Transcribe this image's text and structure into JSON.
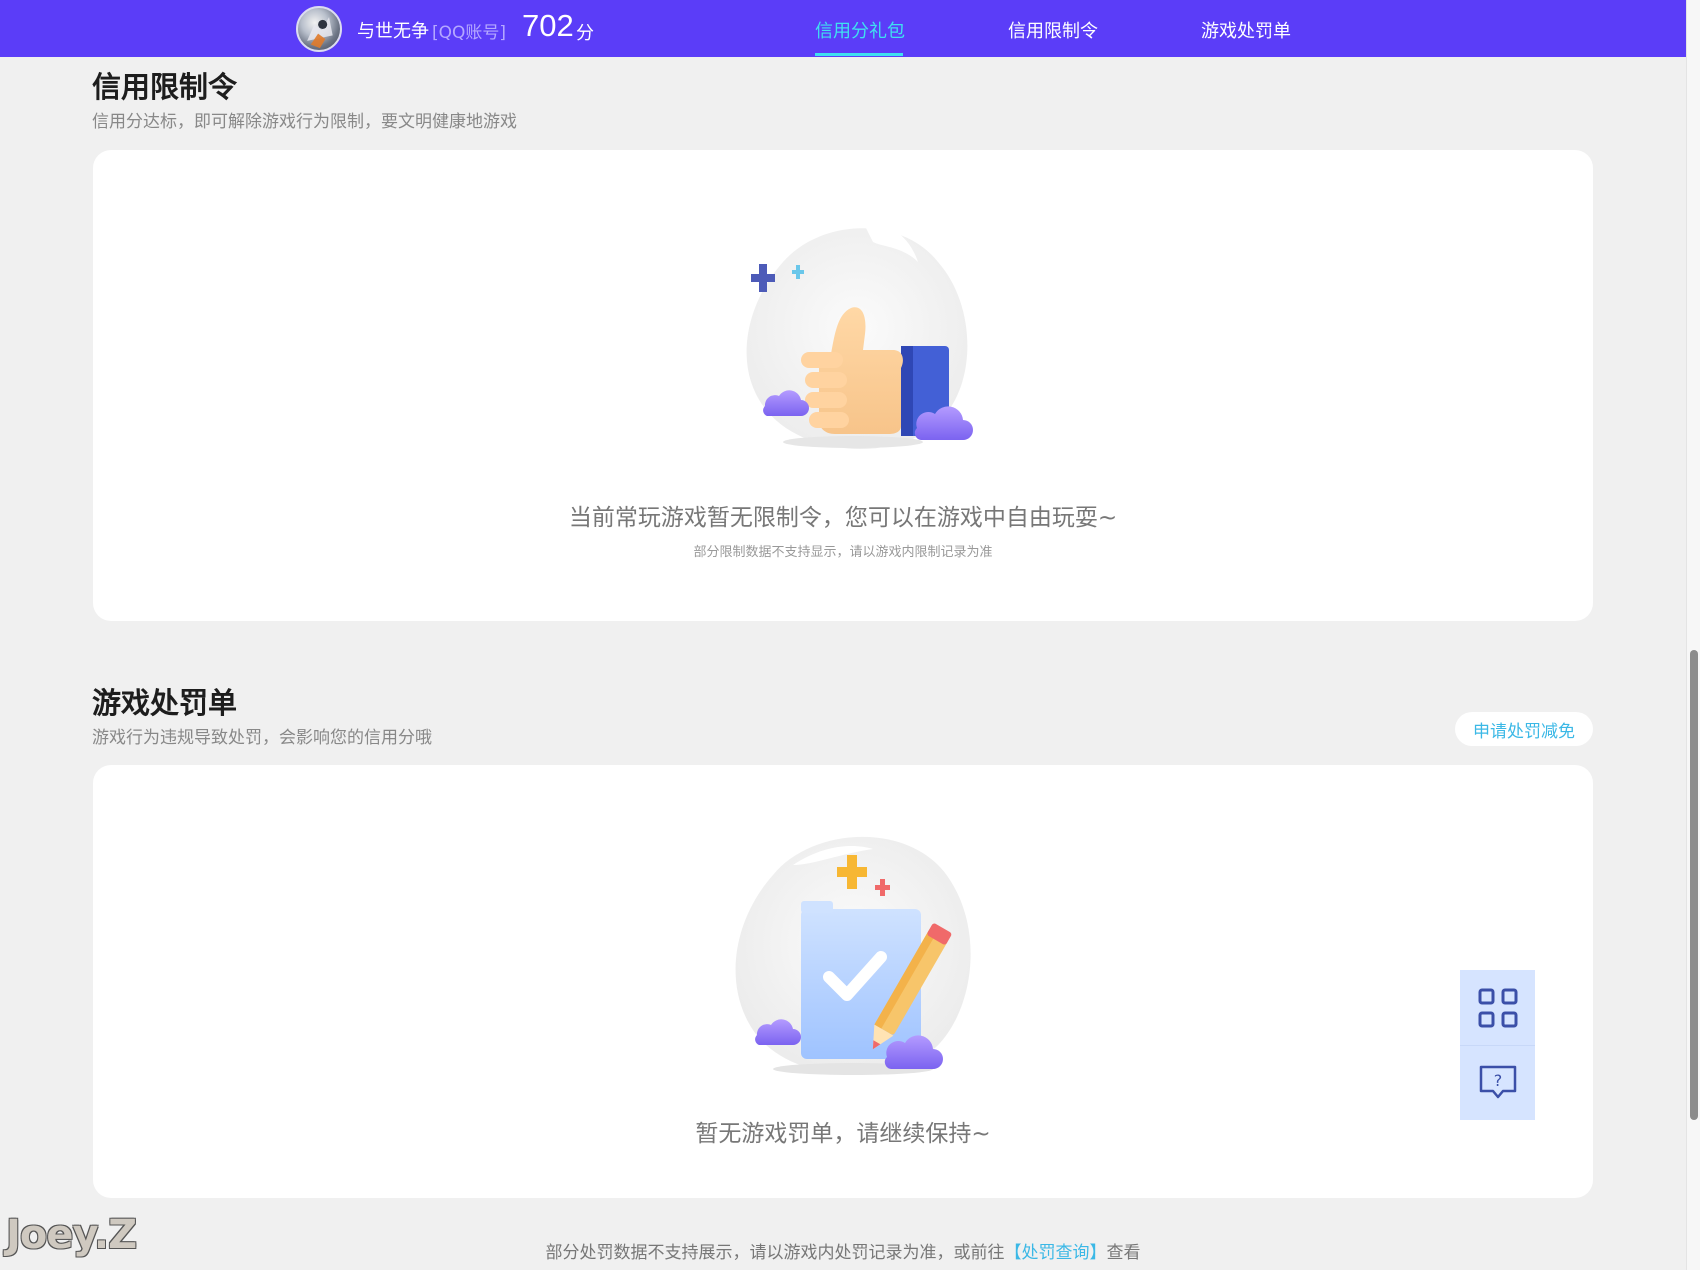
{
  "header": {
    "nickname": "与世无争",
    "account_type": "[QQ账号]",
    "score": "702",
    "score_unit": "分",
    "tabs": [
      {
        "label": "信用分礼包",
        "active": true
      },
      {
        "label": "信用限制令",
        "active": false
      },
      {
        "label": "游戏处罚单",
        "active": false
      }
    ]
  },
  "restrictions": {
    "title": "信用限制令",
    "subtitle": "信用分达标，即可解除游戏行为限制，要文明健康地游戏",
    "empty_text": "当前常玩游戏暂无限制令，您可以在游戏中自由玩耍~",
    "note": "部分限制数据不支持显示，请以游戏内限制记录为准"
  },
  "penalties": {
    "title": "游戏处罚单",
    "subtitle": "游戏行为违规导致处罚，会影响您的信用分哦",
    "appeal_button": "申请处罚减免",
    "empty_text": "暂无游戏罚单，请继续保持~"
  },
  "footer": {
    "prefix": "部分处罚数据不支持展示，请以游戏内处罚记录为准，或前往",
    "link": "【处罚查询】",
    "suffix": "查看"
  },
  "float_tools": {
    "items": [
      {
        "icon": "qr-code-icon"
      },
      {
        "icon": "help-chat-icon"
      }
    ]
  },
  "watermark": "Joey.Z",
  "colors": {
    "header_bg": "#5b3df8",
    "active_tab": "#3fe0f0",
    "link": "#3bb8e6",
    "page_bg": "#f0f0f0"
  }
}
